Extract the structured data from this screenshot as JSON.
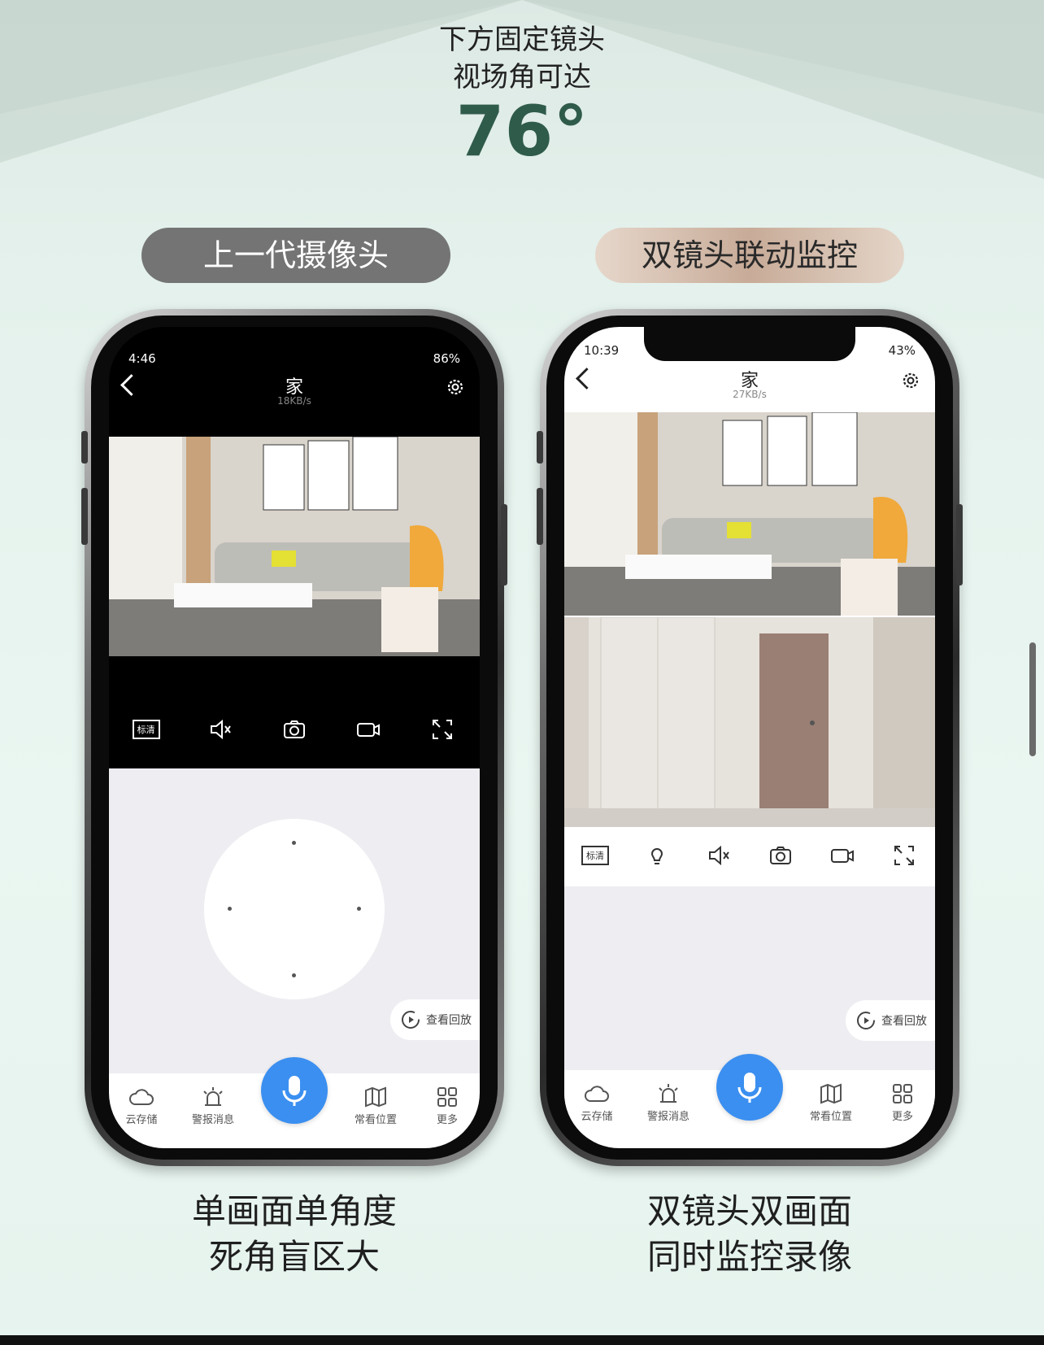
{
  "header": {
    "line1": "下方固定镜头",
    "line2": "视场角可达",
    "angle": "76°"
  },
  "left": {
    "pill": "上一代摄像头",
    "status_time": "4:46",
    "status_battery": "86%",
    "title": "家",
    "rate": "18KB/s",
    "quality": "标清",
    "playback": "查看回放",
    "tabs": [
      "云存储",
      "警报消息",
      "常看位置",
      "更多"
    ],
    "caption_line1": "单画面单角度",
    "caption_line2": "死角盲区大"
  },
  "right": {
    "pill": "双镜头联动监控",
    "status_time": "10:39",
    "status_battery": "43%",
    "title": "家",
    "rate": "27KB/s",
    "quality": "标清",
    "playback": "查看回放",
    "tabs": [
      "云存储",
      "警报消息",
      "常看位置",
      "更多"
    ],
    "caption_line1": "双镜头双画面",
    "caption_line2": "同时监控录像"
  },
  "icons": {
    "control_left": [
      "quality-icon",
      "mute-icon",
      "snapshot-icon",
      "record-icon",
      "fullscreen-icon"
    ],
    "control_right": [
      "quality-icon",
      "light-icon",
      "mute-icon",
      "snapshot-icon",
      "record-icon",
      "fullscreen-icon"
    ],
    "tabs": [
      "cloud-icon",
      "alarm-icon",
      "map-icon",
      "grid-icon"
    ]
  },
  "colors": {
    "accent": "#3b8ff0",
    "pill_old": "#747474",
    "angle": "#2f5b4b"
  }
}
